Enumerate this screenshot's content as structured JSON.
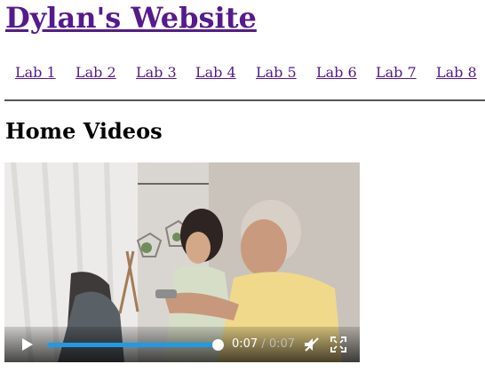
{
  "header": {
    "title": "Dylan's Website"
  },
  "nav": {
    "items": [
      {
        "label": "Lab 1"
      },
      {
        "label": "Lab 2"
      },
      {
        "label": "Lab 3"
      },
      {
        "label": "Lab 4"
      },
      {
        "label": "Lab 5"
      },
      {
        "label": "Lab 6"
      },
      {
        "label": "Lab 7"
      },
      {
        "label": "Lab 8"
      }
    ]
  },
  "main": {
    "heading": "Home Videos",
    "video": {
      "current_time": "0:07",
      "separator": "/",
      "duration": "0:07",
      "progress": 1.0,
      "muted": true,
      "accent_color": "#1e9be6"
    }
  }
}
